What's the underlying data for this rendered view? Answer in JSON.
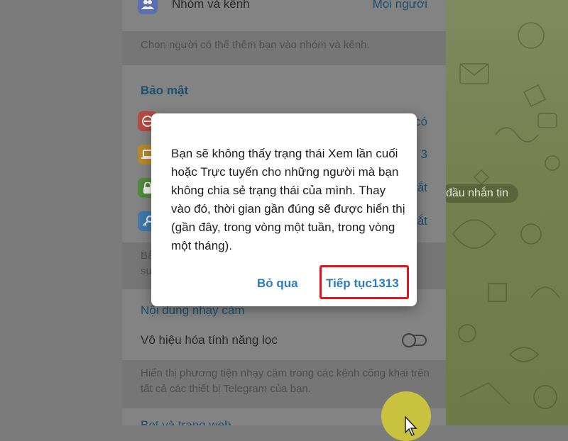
{
  "settings": {
    "groups_row": {
      "label": "Nhóm và kênh",
      "value": "Mọi người",
      "icon": "users-icon"
    },
    "groups_hint": "Chọn người có thể thêm bạn vào nhóm và kênh.",
    "security_title": "Bảo mật",
    "security_rows": [
      {
        "icon": "block-icon",
        "color": "#b64a44",
        "value": "có"
      },
      {
        "icon": "laptop-icon",
        "color": "#b58a2c",
        "value": "3"
      },
      {
        "icon": "lock-icon",
        "color": "#4f8a3c",
        "value": "tắt"
      },
      {
        "icon": "key-icon",
        "color": "#3f78aa",
        "value": "tắt"
      }
    ],
    "security_hint_line1": "Bả",
    "security_hint_line2": "su",
    "sensitive_title": "Nội dung nhạy cảm",
    "filter_label": "Vô hiệu hóa tính năng lọc",
    "filter_hint": "Hiển thị phương tiện nhạy cảm trong các kênh công khai trên tất cả các thiết bị Telegram của bạn.",
    "bottom_title": "Bot và trang web"
  },
  "chat": {
    "hint": "đầu nhắn tin"
  },
  "dialog": {
    "message": "Bạn sẽ không thấy trạng thái Xem lần cuối hoặc Trực tuyến cho những người mà bạn không chia sẻ trạng thái của mình. Thay vào đó, thời gian gần đúng sẽ được hiển thị (gần đây, trong vòng một tuần, trong vòng một tháng).",
    "skip_label": "Bỏ qua",
    "continue_label": "Tiếp tục1313"
  },
  "colors": {
    "accent": "#2b7bbf",
    "highlight": "#e3141c",
    "fab": "#c9c23f"
  }
}
